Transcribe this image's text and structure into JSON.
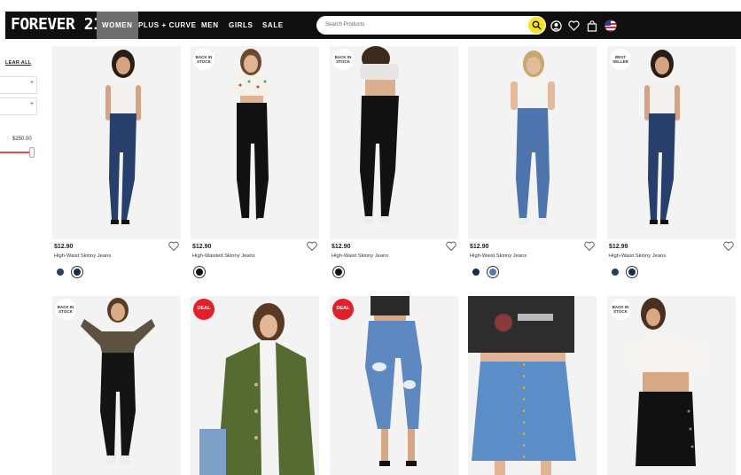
{
  "header": {
    "logo": "FOREVER 21",
    "nav": [
      "WOMEN",
      "PLUS + CURVE",
      "MEN",
      "GIRLS",
      "SALE"
    ],
    "active_nav": "WOMEN",
    "search_placeholder": "Search Products",
    "icons": [
      "account-icon",
      "wishlist-icon",
      "bag-icon",
      "us-flag-icon"
    ]
  },
  "filters": {
    "clear_all": "LEAR ALL",
    "price_max": "$250.00",
    "accent_color": "#e04a4a"
  },
  "products": [
    {
      "price": "$12.90",
      "name": "High-Waist Skinny Jeans",
      "badge": "",
      "swatches": [
        "#27406b",
        "#1c2b4d"
      ],
      "color": "denim"
    },
    {
      "price": "$12.90",
      "name": "High-Waisted Skinny Jeans",
      "badge": "BACK IN STOCK",
      "swatches": [
        "#111111"
      ],
      "color": "black"
    },
    {
      "price": "$12.90",
      "name": "High-Waist Skinny Jeans",
      "badge": "BACK IN STOCK",
      "swatches": [
        "#111111"
      ],
      "color": "black"
    },
    {
      "price": "$12.90",
      "name": "High-Waist Skinny Jeans",
      "badge": "",
      "swatches": [
        "#1c2b4d",
        "#5578b0"
      ],
      "color": "lightdenim"
    },
    {
      "price": "$12.99",
      "name": "High-Waist Skinny Jeans",
      "badge": "BEST SELLER",
      "swatches": [
        "#27406b",
        "#1c2b4d"
      ],
      "color": "denim"
    },
    {
      "badge": "BACK IN STOCK",
      "color": "black-leggings"
    },
    {
      "badge": "DEAL",
      "color": "olive-jacket"
    },
    {
      "badge": "DEAL",
      "color": "ripped-capri"
    },
    {
      "badge": "",
      "color": "denim-skirt"
    },
    {
      "badge": "BACK IN STOCK",
      "color": "black-skirt"
    }
  ]
}
